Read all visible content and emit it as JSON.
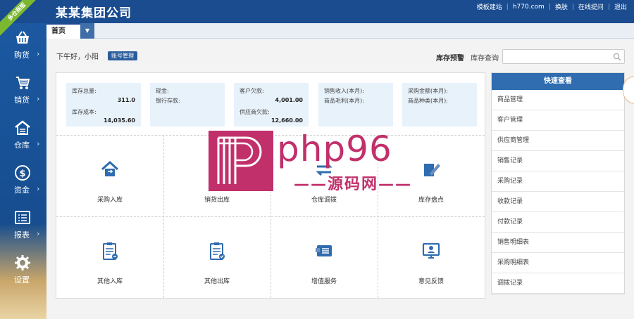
{
  "header": {
    "company": "某某集团公司",
    "ribbon": "多仓商版",
    "links": [
      "模板建站",
      "h770.com",
      "换肤",
      "在线提问",
      "退出"
    ]
  },
  "sidebar": {
    "items": [
      {
        "label": "购货",
        "icon": "basket-icon"
      },
      {
        "label": "销货",
        "icon": "cart-icon"
      },
      {
        "label": "仓库",
        "icon": "warehouse-icon"
      },
      {
        "label": "资金",
        "icon": "dollar-icon"
      },
      {
        "label": "报表",
        "icon": "report-icon"
      },
      {
        "label": "设置",
        "icon": "gear-icon"
      }
    ],
    "arrow": "›"
  },
  "tabs": {
    "home": "首页",
    "dropdown": "▼"
  },
  "greeting": {
    "text": "下午好，小阳",
    "account_button": "账号管理",
    "stock_warning": "库存预警",
    "stock_query": "库存查询"
  },
  "stats": [
    {
      "lines": [
        {
          "label": "库存总量:",
          "value": "311.0"
        },
        {
          "label": "库存成本:",
          "value": "14,035.60"
        }
      ]
    },
    {
      "lines": [
        {
          "label": "现金:",
          "value": ""
        },
        {
          "label": "银行存款:",
          "value": ""
        }
      ]
    },
    {
      "lines": [
        {
          "label": "客户欠款:",
          "value": "4,001.00"
        },
        {
          "label": "供应商欠款:",
          "value": "12,660.00"
        }
      ]
    },
    {
      "lines": [
        {
          "label": "销售收入(本月):",
          "value": ""
        },
        {
          "label": "商品毛利(本月):",
          "value": ""
        }
      ]
    },
    {
      "lines": [
        {
          "label": "采购金额(本月):",
          "value": ""
        },
        {
          "label": "商品种类(本月):",
          "value": ""
        }
      ]
    }
  ],
  "tiles": [
    {
      "label": "采购入库",
      "icon": "purchase-in-icon"
    },
    {
      "label": "销货出库",
      "icon": "sales-out-icon"
    },
    {
      "label": "仓库调拨",
      "icon": "transfer-icon"
    },
    {
      "label": "库存盘点",
      "icon": "inventory-check-icon"
    },
    {
      "label": "其他入库",
      "icon": "other-in-icon"
    },
    {
      "label": "其他出库",
      "icon": "other-out-icon"
    },
    {
      "label": "增值服务",
      "icon": "value-added-icon"
    },
    {
      "label": "意见反馈",
      "icon": "feedback-icon"
    }
  ],
  "quick": {
    "title": "快速查看",
    "items": [
      "商品管理",
      "客户管理",
      "供应商管理",
      "销售记录",
      "采购记录",
      "收款记录",
      "付款记录",
      "销售明细表",
      "采购明细表",
      "调拨记录"
    ]
  },
  "watermark": {
    "text": "php96",
    "sub": "——源码网——"
  },
  "colors": {
    "header_blue": "#1a4c8f",
    "accent_blue": "#2f6cb0",
    "watermark": "#c1306b",
    "ribbon_green": "#7cb82f"
  }
}
